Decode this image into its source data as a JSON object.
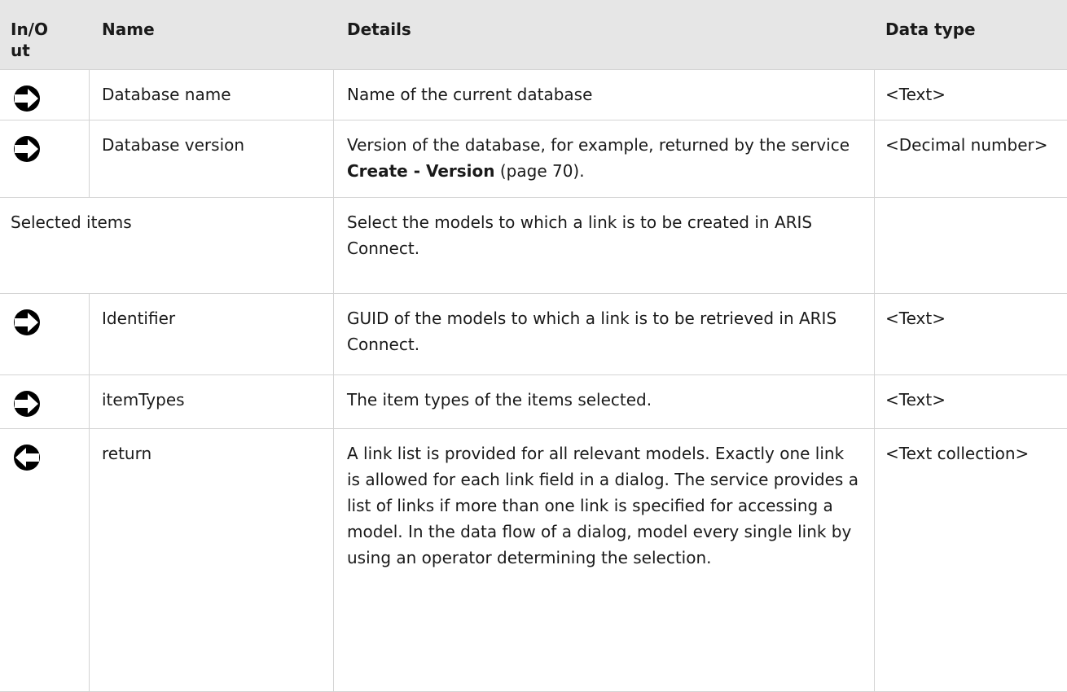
{
  "table": {
    "headers": {
      "in_out": "In/O\nut",
      "name": "Name",
      "details": "Details",
      "data_type": "Data type"
    },
    "rows": [
      {
        "direction_icon": "input-arrow-icon",
        "name": "Database name",
        "details": "Name of the current database",
        "data_type": "<Text>"
      },
      {
        "direction_icon": "input-arrow-icon",
        "name": "Database version",
        "details_prefix": "Version of the database, for example, returned by the service ",
        "details_bold": "Create - Version",
        "details_suffix": " (page 70).",
        "data_type": "<Decimal number>"
      },
      {
        "group_label": "Selected items",
        "details": "Select the models to which a link is to be created in ARIS Connect."
      },
      {
        "direction_icon": "input-arrow-icon",
        "name": "Identifier",
        "details": "GUID of the models to which a link is to be retrieved in ARIS Connect.",
        "data_type": "<Text>"
      },
      {
        "direction_icon": "input-arrow-icon",
        "name": "itemTypes",
        "details": "The item types of the items selected.",
        "data_type": "<Text>"
      },
      {
        "direction_icon": "output-arrow-icon",
        "name": "return",
        "details": "A link list is provided for all relevant models. Exactly one link is allowed for each link field in a dialog. The service provides a list of links if more than one link is specified for accessing a model. In the data flow of a dialog, model every single link by using an operator determining the selection.",
        "data_type": "<Text collection>"
      }
    ]
  }
}
